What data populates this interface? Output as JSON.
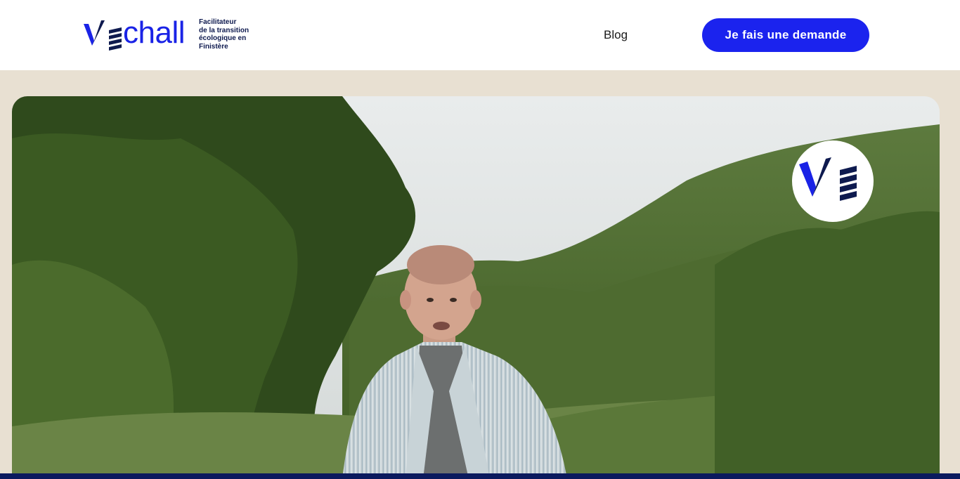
{
  "header": {
    "logo_text": "chall",
    "logo_alt": "Vechall",
    "tagline_lines": [
      "Facilitateur",
      "de la transition",
      "écologique en Finistère"
    ],
    "nav_blog": "Blog",
    "cta_label": "Je fais une demande"
  },
  "hero": {
    "media": "video-still-man-in-forest-valley",
    "badge_icon": "vechall-logo-icon"
  },
  "colors": {
    "brand_blue": "#1b23ee",
    "navy": "#0b1a5e",
    "beige": "#e8e0d2",
    "white": "#ffffff"
  }
}
